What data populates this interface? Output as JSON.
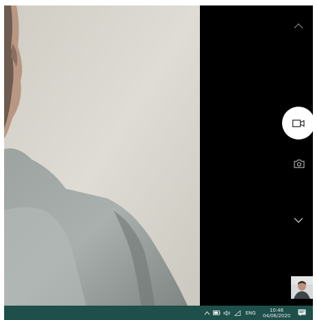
{
  "app": {
    "name": "Camera",
    "controls": {
      "scroll_up_icon": "chevron-up-icon",
      "video_mode_icon": "video-camera-icon",
      "photo_mode_icon": "camera-icon",
      "scroll_down_icon": "chevron-down-icon",
      "last_capture_thumbnail": "thumbnail-image"
    }
  },
  "taskbar": {
    "language": "ENG",
    "time": "10:46",
    "date": "04/06/2020",
    "tray_icons": [
      "chevron-up-icon",
      "battery-icon",
      "volume-icon",
      "wifi-icon"
    ],
    "notification_icon": "action-center-icon"
  },
  "colors": {
    "control_panel": "#000000",
    "capture_button": "#ffffff",
    "taskbar": "#1e4f4a",
    "taskbar_text": "#e8efee"
  }
}
